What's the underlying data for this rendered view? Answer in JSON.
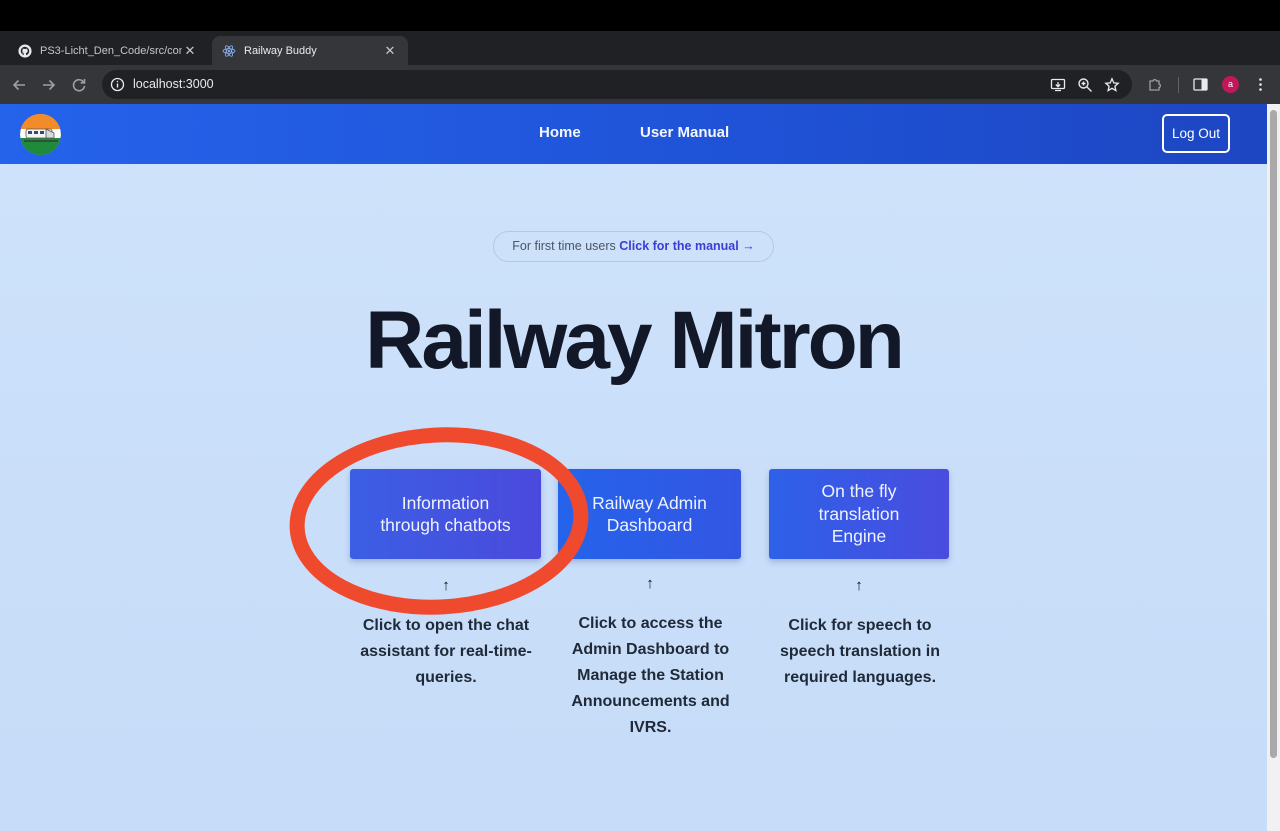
{
  "browser": {
    "tabs": [
      {
        "title": "PS3-Licht_Den_Code/src/con",
        "icon": "github-icon",
        "active": false
      },
      {
        "title": "Railway Buddy",
        "icon": "react-icon",
        "active": true
      }
    ],
    "url": "localhost:3000",
    "profile_initial": "a"
  },
  "navbar": {
    "links": [
      "Home",
      "User Manual"
    ],
    "logout_label": "Log Out",
    "logo": "railway-logo"
  },
  "hero": {
    "pill_prefix": "For first time users",
    "pill_link": "Click for the manual →",
    "title": "Railway Mitron"
  },
  "cards": [
    {
      "title": "Information through chatbots",
      "arrow": "↑",
      "description": "Click to open the chat assistant for real-time-queries."
    },
    {
      "title": "Railway Admin Dashboard",
      "arrow": "↑",
      "description": "Click to access the Admin Dashboard to Manage the Station Announcements and IVRS."
    },
    {
      "title": "On the fly translation Engine",
      "arrow": "↑",
      "description": "Click for speech to speech translation in required languages."
    }
  ],
  "colors": {
    "nav_blue": "#2563eb",
    "page_bg": "#cfe3fb",
    "annotation_red": "#f04a2e",
    "title_dark": "#121827"
  }
}
